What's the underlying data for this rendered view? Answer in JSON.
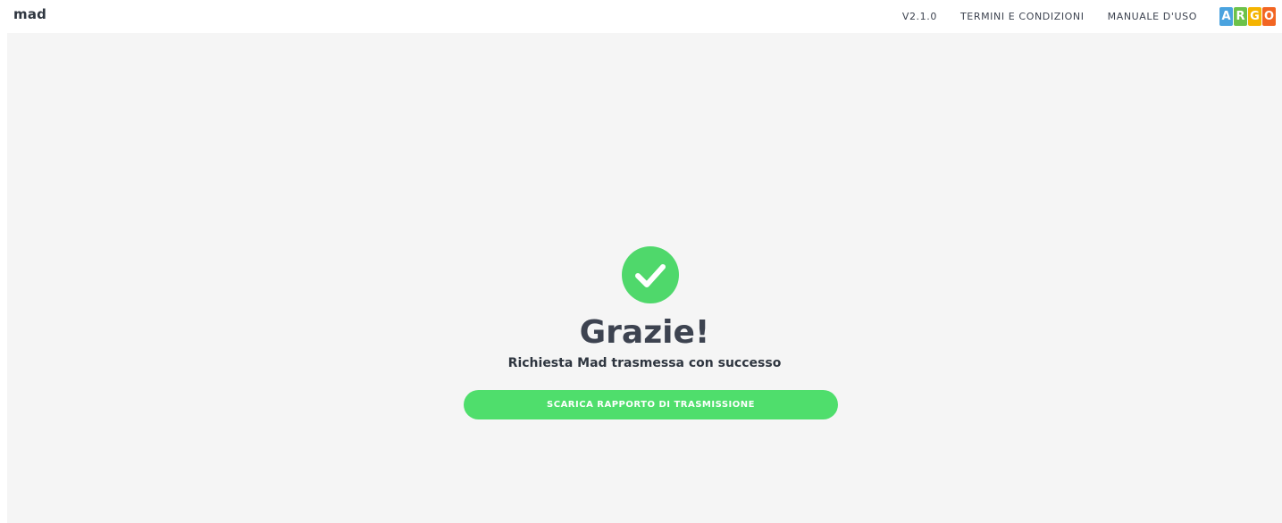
{
  "header": {
    "brand": "mad",
    "version": "V2.1.0",
    "nav": {
      "terms": "TERMINI E CONDIZIONI",
      "manual": "MANUALE D'USO"
    },
    "logo": {
      "letters": [
        "A",
        "R",
        "G",
        "O"
      ],
      "colors": [
        "#4aa3df",
        "#6cc24a",
        "#f5b400",
        "#f26522"
      ]
    }
  },
  "main": {
    "icon": "check-circle-icon",
    "title": "Grazie!",
    "subtitle": "Richiesta Mad trasmessa con successo",
    "download_label": "SCARICA RAPPORTO DI TRASMISSIONE"
  },
  "colors": {
    "success": "#4fde6c",
    "text": "#3d4350",
    "background": "#f5f5f5"
  }
}
